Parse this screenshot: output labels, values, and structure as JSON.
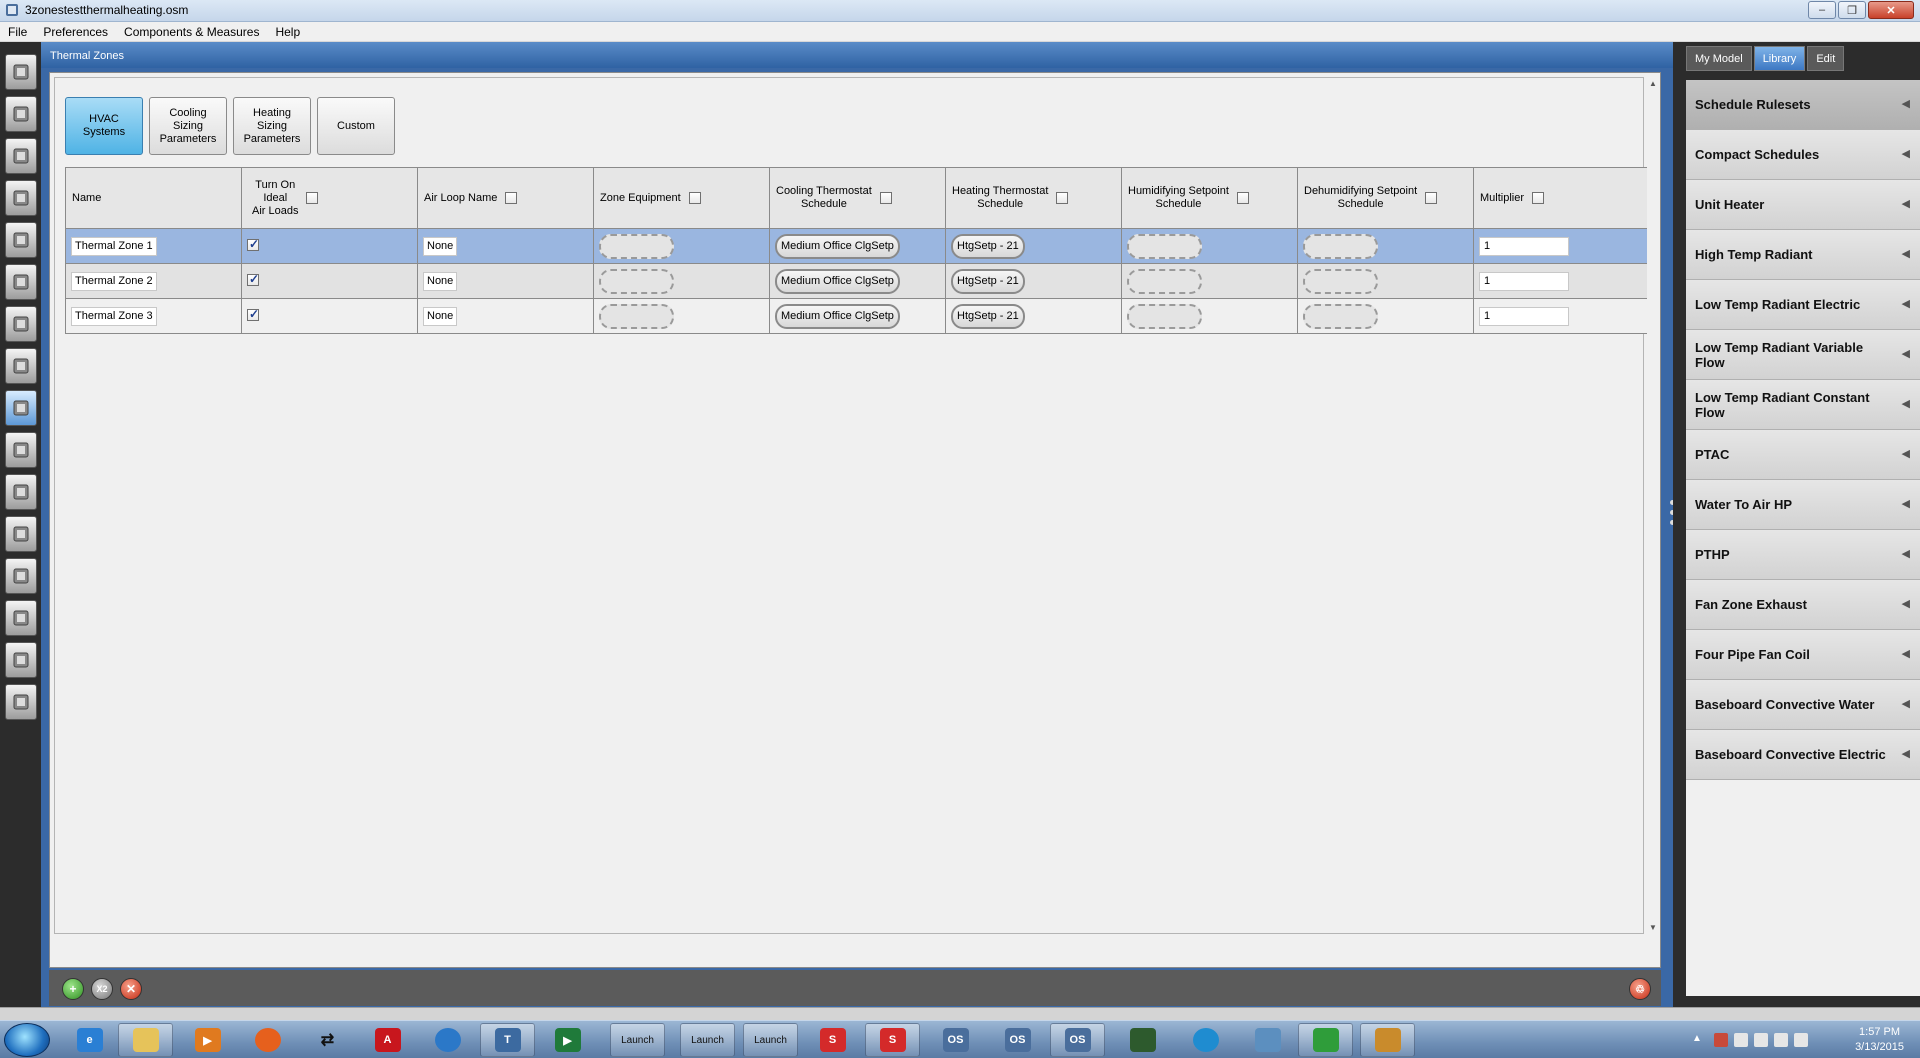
{
  "window": {
    "title": "3zonestestthermalheating.osm",
    "minimize": "–",
    "maximize": "❐",
    "close": "✕"
  },
  "menu": [
    "File",
    "Preferences",
    "Components & Measures",
    "Help"
  ],
  "main": {
    "header": "Thermal Zones",
    "subtabs": [
      {
        "label": "HVAC\nSystems",
        "active": true
      },
      {
        "label": "Cooling\nSizing\nParameters",
        "active": false
      },
      {
        "label": "Heating\nSizing\nParameters",
        "active": false
      },
      {
        "label": "Custom",
        "active": false
      }
    ],
    "columns": [
      {
        "label": "Name",
        "checkbox": false
      },
      {
        "label": "Turn On\nIdeal\nAir Loads",
        "checkbox": true
      },
      {
        "label": "Air Loop Name",
        "checkbox": true
      },
      {
        "label": "Zone Equipment",
        "checkbox": true
      },
      {
        "label": "Cooling Thermostat\nSchedule",
        "checkbox": true
      },
      {
        "label": "Heating Thermostat\nSchedule",
        "checkbox": true
      },
      {
        "label": "Humidifying Setpoint\nSchedule",
        "checkbox": true
      },
      {
        "label": "Dehumidifying Setpoint\nSchedule",
        "checkbox": true
      },
      {
        "label": "Multiplier",
        "checkbox": true
      }
    ],
    "rows": [
      {
        "name": "Thermal Zone 1",
        "ideal_air_loads": true,
        "air_loop": "None",
        "cooling": "Medium Office ClgSetp",
        "heating": "HtgSetp - 21",
        "multiplier": "1",
        "selected": true
      },
      {
        "name": "Thermal Zone 2",
        "ideal_air_loads": true,
        "air_loop": "None",
        "cooling": "Medium Office ClgSetp",
        "heating": "HtgSetp - 21",
        "multiplier": "1",
        "selected": false
      },
      {
        "name": "Thermal Zone 3",
        "ideal_air_loads": true,
        "air_loop": "None",
        "cooling": "Medium Office ClgSetp",
        "heating": "HtgSetp - 21",
        "multiplier": "1",
        "selected": false
      }
    ],
    "actions": {
      "add": "+",
      "copy": "X2",
      "delete": "✕",
      "purge": "♲"
    }
  },
  "sidebar": {
    "tabs": [
      {
        "label": "My Model",
        "active": false
      },
      {
        "label": "Library",
        "active": true
      },
      {
        "label": "Edit",
        "active": false
      }
    ],
    "items": [
      "Schedule Rulesets",
      "Compact Schedules",
      "Unit Heater",
      "High Temp Radiant",
      "Low Temp Radiant Electric",
      "Low Temp Radiant Variable Flow",
      "Low Temp Radiant Constant Flow",
      "PTAC",
      "Water To Air HP",
      "PTHP",
      "Fan Zone Exhaust",
      "Four Pipe Fan Coil",
      "Baseboard Convective Water",
      "Baseboard Convective Electric"
    ],
    "arrow": "◀"
  },
  "left_tools": [
    "site-icon",
    "schedules-icon",
    "constructions-icon",
    "loads-icon",
    "space-types-icon",
    "geometry-icon",
    "facility-icon",
    "spaces-icon",
    "thermal-zones-icon",
    "hvac-systems-icon",
    "building-summary-icon",
    "outputs-icon",
    "simulation-settings-icon",
    "scripts-icon",
    "run-simulation-icon",
    "results-summary-icon"
  ],
  "taskbar": {
    "launch_label": "Launch",
    "os_label": "OS",
    "time": "1:57 PM",
    "date": "3/13/2015"
  }
}
